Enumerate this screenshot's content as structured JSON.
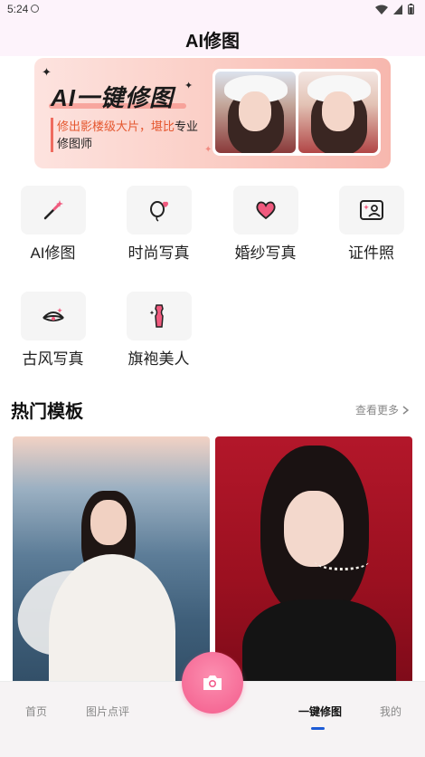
{
  "status_bar": {
    "time": "5:24"
  },
  "header": {
    "title": "AI修图"
  },
  "banner": {
    "title": "AI一键修图",
    "subtitle_pre": "修出影楼级大片，堪比",
    "subtitle_post": "专业修图师"
  },
  "categories": [
    {
      "label": "AI修图",
      "icon": "magic-wand-icon"
    },
    {
      "label": "时尚写真",
      "icon": "balloon-heart-icon"
    },
    {
      "label": "婚纱写真",
      "icon": "heart-icon"
    },
    {
      "label": "证件照",
      "icon": "id-photo-icon"
    },
    {
      "label": "古风写真",
      "icon": "fan-icon"
    },
    {
      "label": "旗袍美人",
      "icon": "qipao-icon"
    }
  ],
  "templates": {
    "title": "热门模板",
    "see_more": "查看更多"
  },
  "bottom_nav": {
    "items": [
      "首页",
      "图片点评",
      "一键修图",
      "我的"
    ],
    "active": "一键修图"
  },
  "colors": {
    "accent_pink": "#f35c8c",
    "nav_indicator": "#1d5bd6",
    "banner_highlight": "#e5572f"
  }
}
